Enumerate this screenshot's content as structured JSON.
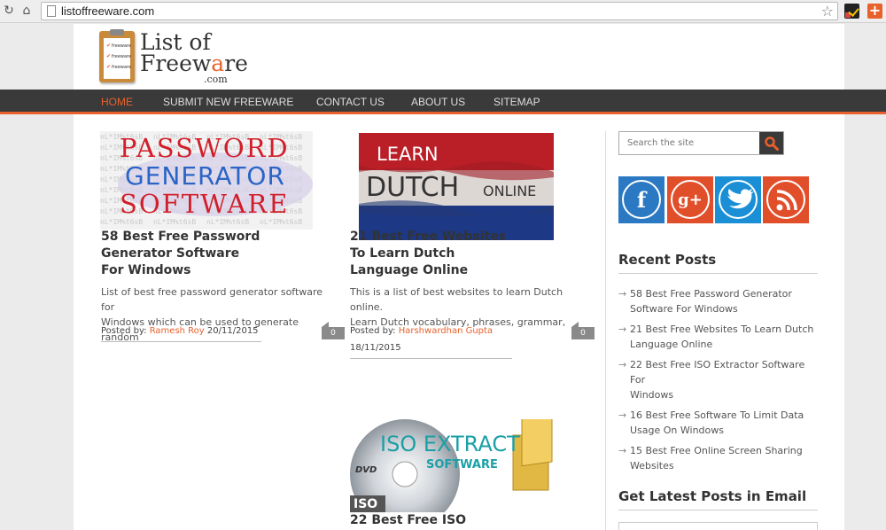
{
  "browser": {
    "url": "listoffreeware.com"
  },
  "logo": {
    "line1": "List of",
    "line2a": "Freew",
    "line2b": "a",
    "line2c": "re",
    "line3": ".com",
    "clip_items": [
      "freeware",
      "freeware",
      "freeware"
    ]
  },
  "nav": {
    "items": [
      "HOME",
      "SUBMIT NEW FREEWARE",
      "CONTACT US",
      "ABOUT US",
      "SITEMAP"
    ]
  },
  "posts": [
    {
      "thumb_lines": [
        "PASSWORD",
        "GENERATOR",
        "SOFTWARE"
      ],
      "title_lines": [
        "58 Best Free Password",
        "Generator Software",
        "For Windows"
      ],
      "excerpt_lines": [
        "List of best free password generator software for",
        "Windows which can be used to generate random"
      ],
      "posted_by": "Posted by:",
      "author": "Ramesh Roy",
      "date": "20/11/2015",
      "comments": "0"
    },
    {
      "thumb_lines": [
        "LEARN",
        "DUTCH",
        "ONLINE"
      ],
      "title_lines": [
        "21 Best Free Websites",
        "To Learn Dutch",
        "Language Online"
      ],
      "excerpt_lines": [
        "This is a list of best websites to learn Dutch online.",
        "Learn Dutch vocabulary, phrases, grammar,"
      ],
      "posted_by": "Posted by:",
      "author": "Harshwardhan Gupta",
      "date": "18/11/2015",
      "comments": "0"
    },
    {
      "thumb_lines": [
        "ISO EXTRACT",
        "SOFTWARE",
        "DVD",
        "ISO"
      ],
      "title_lines": [
        "22 Best Free ISO"
      ]
    }
  ],
  "sidebar": {
    "search_placeholder": "Search the site",
    "social": [
      "facebook-icon",
      "google-plus-icon",
      "twitter-icon",
      "rss-icon"
    ],
    "recent_heading": "Recent Posts",
    "recent": [
      [
        "58 Best Free Password Generator",
        "Software For Windows"
      ],
      [
        "21 Best Free Websites To Learn Dutch",
        "Language Online"
      ],
      [
        "22 Best Free ISO Extractor Software For",
        "Windows"
      ],
      [
        "16 Best Free Software To Limit Data",
        "Usage On Windows"
      ],
      [
        "15 Best Free Online Screen Sharing",
        "Websites"
      ]
    ],
    "email_heading": "Get Latest Posts in Email"
  },
  "colors": {
    "accent": "#e8612c",
    "nav_bg": "#3a3a3a"
  }
}
